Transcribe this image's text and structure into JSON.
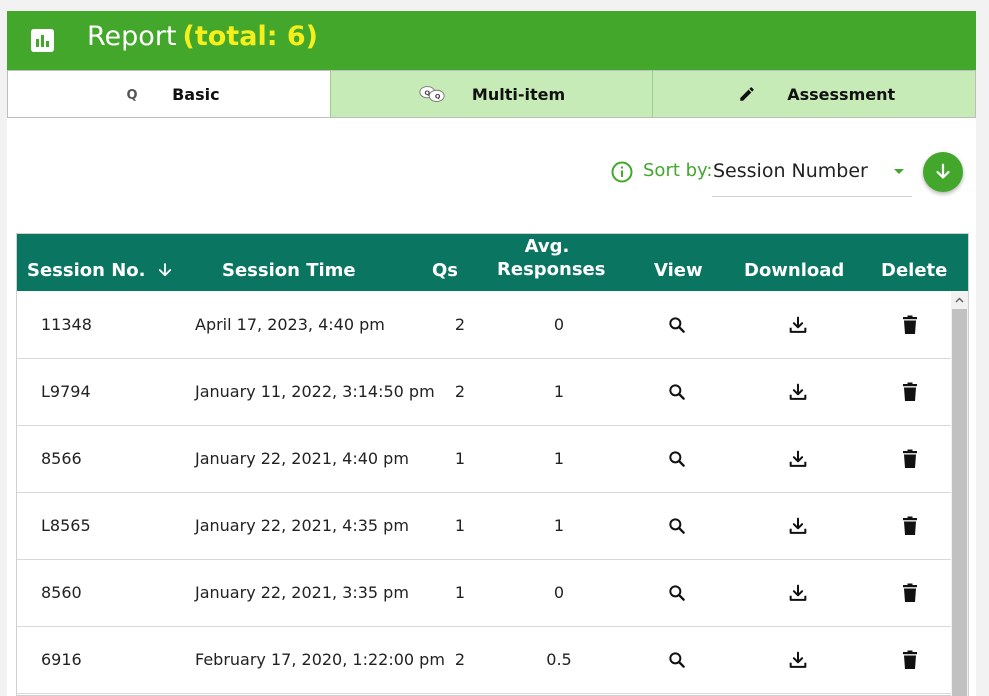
{
  "header": {
    "title": "Report",
    "total": "(total: 6)"
  },
  "tabs": [
    {
      "label": "Basic",
      "icon": "basic-q-icon",
      "active": true
    },
    {
      "label": "Multi-item",
      "icon": "multi-item-icon",
      "active": false
    },
    {
      "label": "Assessment",
      "icon": "pencil-icon",
      "active": false
    }
  ],
  "sort": {
    "label": "Sort by:",
    "value": "Session Number",
    "direction": "descending"
  },
  "table": {
    "columns": {
      "session_no": "Session No.",
      "session_time": "Session Time",
      "qs": "Qs",
      "avg_line1": "Avg.",
      "avg_line2": "Responses",
      "view": "View",
      "download": "Download",
      "delete": "Delete"
    },
    "rows": [
      {
        "session_no": "11348",
        "session_time": "April 17, 2023, 4:40 pm",
        "qs": "2",
        "avg": "0"
      },
      {
        "session_no": "L9794",
        "session_time": "January 11, 2022, 3:14:50 pm",
        "qs": "2",
        "avg": "1"
      },
      {
        "session_no": "8566",
        "session_time": "January 22, 2021, 4:40 pm",
        "qs": "1",
        "avg": "1"
      },
      {
        "session_no": "L8565",
        "session_time": "January 22, 2021, 4:35 pm",
        "qs": "1",
        "avg": "1"
      },
      {
        "session_no": "8560",
        "session_time": "January 22, 2021, 3:35 pm",
        "qs": "1",
        "avg": "0"
      },
      {
        "session_no": "6916",
        "session_time": "February 17, 2020, 1:22:00 pm",
        "qs": "2",
        "avg": "0.5"
      }
    ]
  },
  "colors": {
    "header_green": "#43a72c",
    "total_yellow": "#f5ef1b",
    "tab_inactive": "#c7ebb7",
    "table_header": "#0a7561"
  }
}
